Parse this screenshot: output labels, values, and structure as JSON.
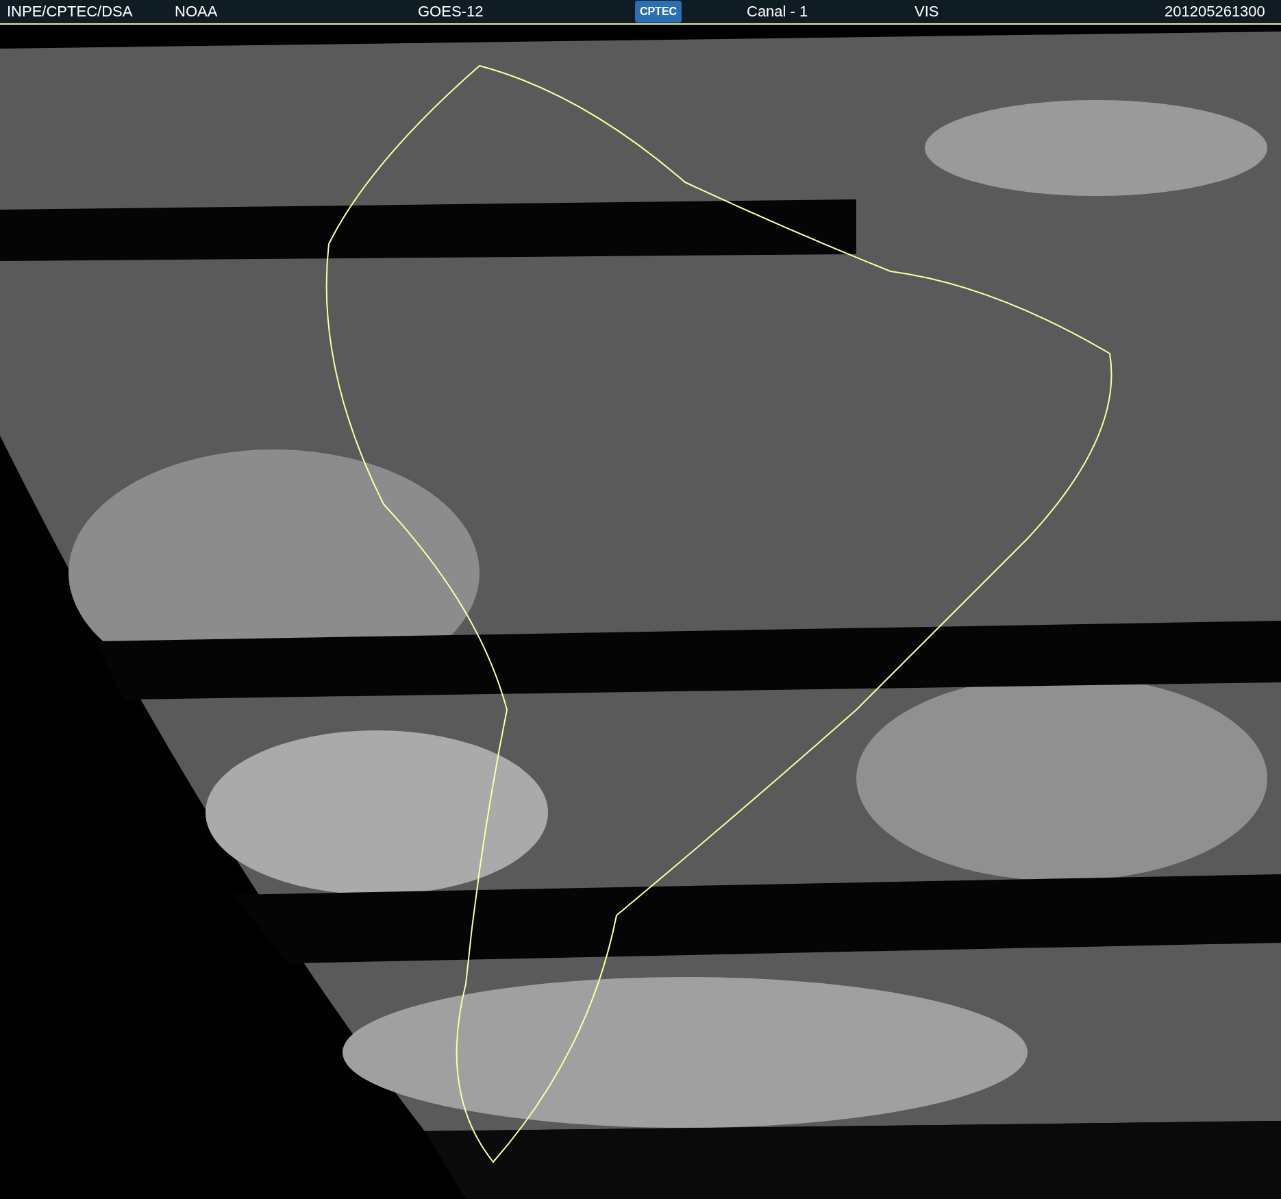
{
  "header": {
    "source": "INPE/CPTEC/DSA",
    "agency": "NOAA",
    "satellite": "GOES-12",
    "logo": "CPTEC",
    "channel": "Canal - 1",
    "band": "VIS",
    "timestamp": "201205261300"
  }
}
